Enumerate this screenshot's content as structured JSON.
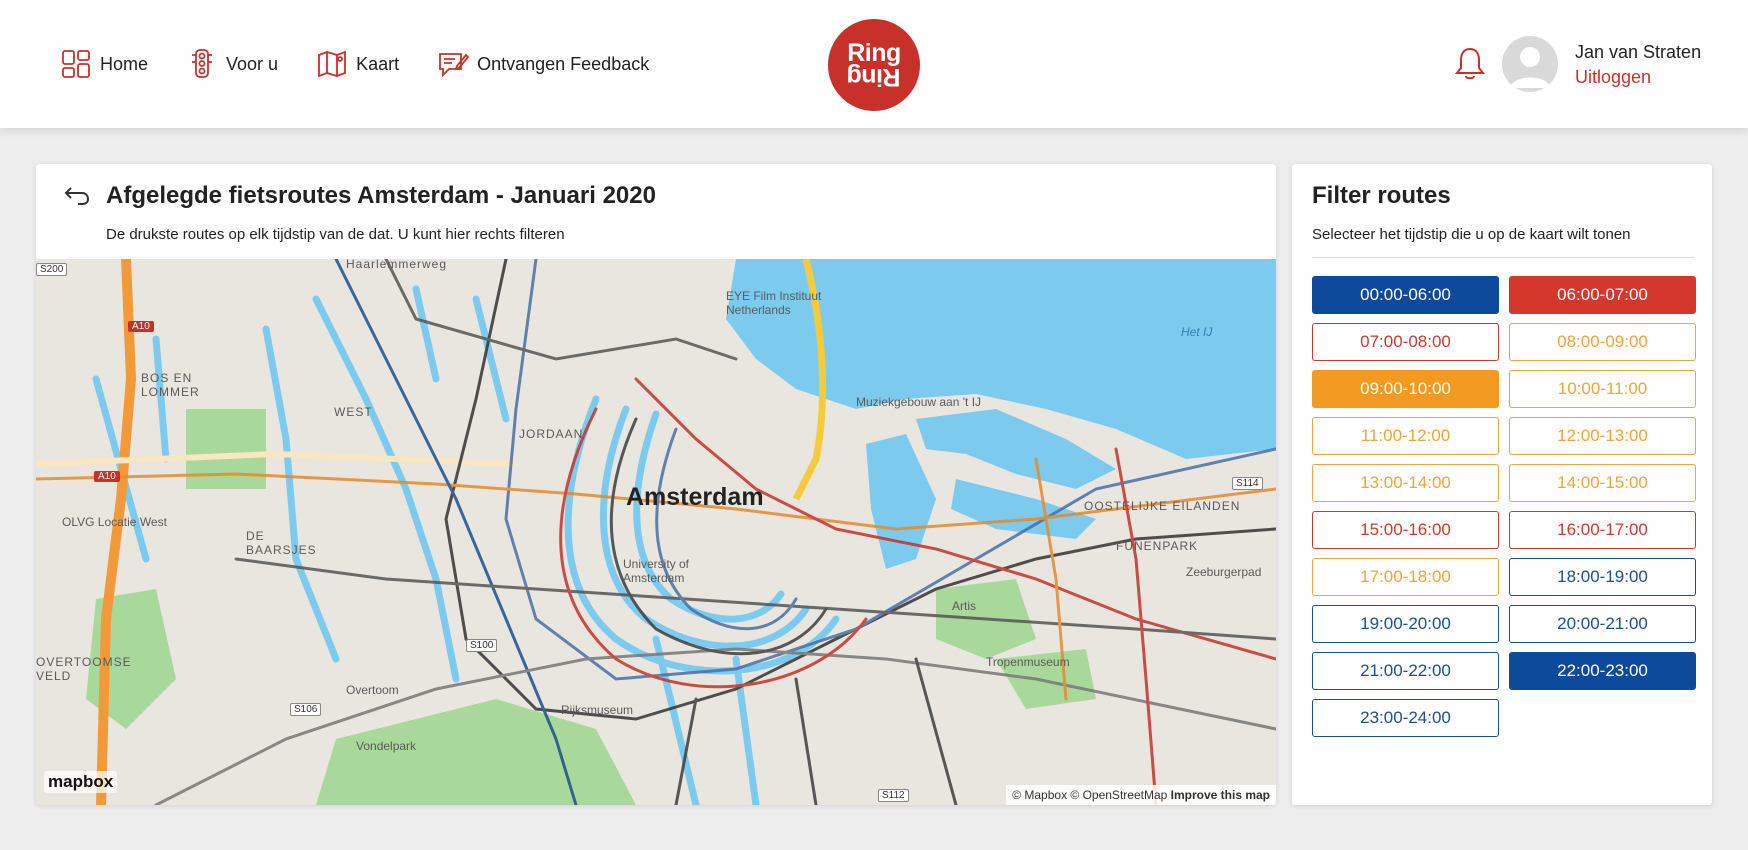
{
  "nav": {
    "items": [
      {
        "label": "Home",
        "icon": "home-grid-icon"
      },
      {
        "label": "Voor u",
        "icon": "traffic-light-icon"
      },
      {
        "label": "Kaart",
        "icon": "map-icon"
      },
      {
        "label": "Ontvangen Feedback",
        "icon": "feedback-icon"
      }
    ],
    "logo_top": "Ring",
    "logo_bottom": "Ring"
  },
  "user": {
    "name": "Jan van Straten",
    "logout": "Uitloggen",
    "notification_icon": "bell-icon"
  },
  "main": {
    "title": "Afgelegde fietsroutes Amsterdam - Januari 2020",
    "subtitle": "De drukste routes op elk tijdstip van de dat. U kunt hier rechts filteren",
    "map": {
      "city": "Amsterdam",
      "labels": [
        "Haarlemmerweg",
        "BOS EN LOMMER",
        "WEST",
        "JORDAAN",
        "DE BAARSJES",
        "EYE Film Instituut Netherlands",
        "Muziekgebouw aan 't IJ",
        "Het IJ",
        "University of Amsterdam",
        "Artis",
        "Tropenmuseum",
        "Rijksmuseum",
        "Vondelpark",
        "Overtoom",
        "OVERTOOMSE VELD",
        "OLVG Locatie West",
        "OOSTELIJKE EILANDEN",
        "Zeeburgerpad",
        "FUNENPARK"
      ],
      "road_shields": [
        "A10",
        "A10",
        "S100",
        "S106",
        "S112",
        "S114",
        "S200"
      ],
      "mapbox_logo": "mapbox",
      "attribution": "© Mapbox © OpenStreetMap",
      "improve": "Improve this map"
    }
  },
  "filter": {
    "title": "Filter routes",
    "subtitle": "Selecteer het tijdstip die u op de kaart wilt tonen",
    "slots": [
      {
        "label": "00:00-06:00",
        "color": "#0d4a9c",
        "filled": true
      },
      {
        "label": "06:00-07:00",
        "color": "#d5372c",
        "filled": true
      },
      {
        "label": "07:00-08:00",
        "color": "#d0382f",
        "filled": false
      },
      {
        "label": "08:00-09:00",
        "color": "#f2a33a",
        "filled": false
      },
      {
        "label": "09:00-10:00",
        "color": "#f39a22",
        "filled": true
      },
      {
        "label": "10:00-11:00",
        "color": "#f2a33a",
        "filled": false
      },
      {
        "label": "11:00-12:00",
        "color": "#f2a33a",
        "filled": false
      },
      {
        "label": "12:00-13:00",
        "color": "#f2a33a",
        "filled": false
      },
      {
        "label": "13:00-14:00",
        "color": "#f2a33a",
        "filled": false
      },
      {
        "label": "14:00-15:00",
        "color": "#f2a33a",
        "filled": false
      },
      {
        "label": "15:00-16:00",
        "color": "#d0382f",
        "filled": false
      },
      {
        "label": "16:00-17:00",
        "color": "#d0382f",
        "filled": false
      },
      {
        "label": "17:00-18:00",
        "color": "#f2a33a",
        "filled": false
      },
      {
        "label": "18:00-19:00",
        "color": "#1c4f8f",
        "filled": false
      },
      {
        "label": "19:00-20:00",
        "color": "#1c4f8f",
        "filled": false
      },
      {
        "label": "20:00-21:00",
        "color": "#1c4f8f",
        "filled": false
      },
      {
        "label": "21:00-22:00",
        "color": "#1c4f8f",
        "filled": false
      },
      {
        "label": "22:00-23:00",
        "color": "#0d4a9c",
        "filled": true
      },
      {
        "label": "23:00-24:00",
        "color": "#1c4f8f",
        "filled": false
      }
    ]
  },
  "colors": {
    "brand": "#c8302a",
    "water": "#7ccbee",
    "park": "#a9d99a"
  }
}
